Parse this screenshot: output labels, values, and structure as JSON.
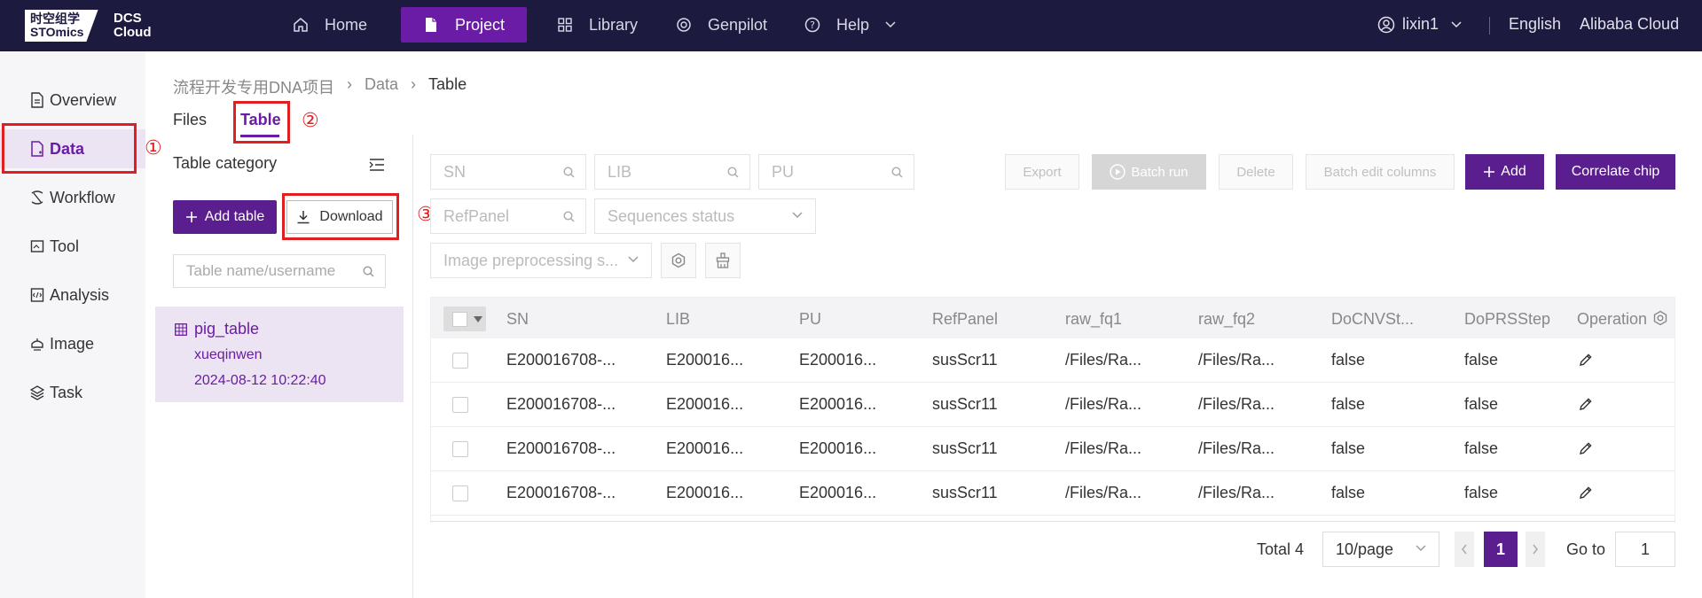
{
  "brand": {
    "logo_cn": "时空组学",
    "logo_en": "STOmics",
    "product_line1": "DCS",
    "product_line2": "Cloud"
  },
  "nav": {
    "home": "Home",
    "project": "Project",
    "library": "Library",
    "genpilot": "Genpilot",
    "help": "Help"
  },
  "user": {
    "name": "lixin1",
    "language": "English",
    "cloud": "Alibaba Cloud"
  },
  "sidebar": {
    "items": [
      {
        "label": "Overview",
        "icon": "document-icon"
      },
      {
        "label": "Data",
        "icon": "data-file-icon",
        "active": true
      },
      {
        "label": "Workflow",
        "icon": "workflow-icon"
      },
      {
        "label": "Tool",
        "icon": "tool-icon"
      },
      {
        "label": "Analysis",
        "icon": "analysis-icon"
      },
      {
        "label": "Image",
        "icon": "image-icon"
      },
      {
        "label": "Task",
        "icon": "task-icon"
      }
    ]
  },
  "breadcrumb": {
    "project": "流程开发专用DNA项目",
    "data": "Data",
    "current": "Table"
  },
  "tabs": {
    "files": "Files",
    "table": "Table"
  },
  "annotations": {
    "one": "①",
    "two": "②",
    "three": "③"
  },
  "left_panel": {
    "title": "Table category",
    "add_table": "Add table",
    "download": "Download",
    "search_placeholder": "Table name/username",
    "table": {
      "name": "pig_table",
      "user": "xueqinwen",
      "time": "2024-08-12 10:22:40"
    }
  },
  "filters": {
    "sn": "SN",
    "lib": "LIB",
    "pu": "PU",
    "refpanel": "RefPanel",
    "seq_status": "Sequences status",
    "image_preprocessing": "Image preprocessing s..."
  },
  "actions": {
    "export": "Export",
    "batch_run": "Batch run",
    "delete": "Delete",
    "batch_edit": "Batch edit columns",
    "add": "Add",
    "correlate": "Correlate chip"
  },
  "table": {
    "columns": [
      "SN",
      "LIB",
      "PU",
      "RefPanel",
      "raw_fq1",
      "raw_fq2",
      "DoCNVSt...",
      "DoPRSStep",
      "Operation"
    ],
    "rows": [
      [
        "E200016708-...",
        "E200016...",
        "E200016...",
        "susScr11",
        "/Files/Ra...",
        "/Files/Ra...",
        "false",
        "false"
      ],
      [
        "E200016708-...",
        "E200016...",
        "E200016...",
        "susScr11",
        "/Files/Ra...",
        "/Files/Ra...",
        "false",
        "false"
      ],
      [
        "E200016708-...",
        "E200016...",
        "E200016...",
        "susScr11",
        "/Files/Ra...",
        "/Files/Ra...",
        "false",
        "false"
      ],
      [
        "E200016708-...",
        "E200016...",
        "E200016...",
        "susScr11",
        "/Files/Ra...",
        "/Files/Ra...",
        "false",
        "false"
      ]
    ]
  },
  "pagination": {
    "total": "Total 4",
    "page_size": "10/page",
    "current": "1",
    "goto_label": "Go to",
    "goto_value": "1"
  },
  "colors": {
    "topbar": "#1d1a3f",
    "accent": "#6a1ca6",
    "primary_button": "#5b1e8e",
    "annotation": "#e02020"
  }
}
